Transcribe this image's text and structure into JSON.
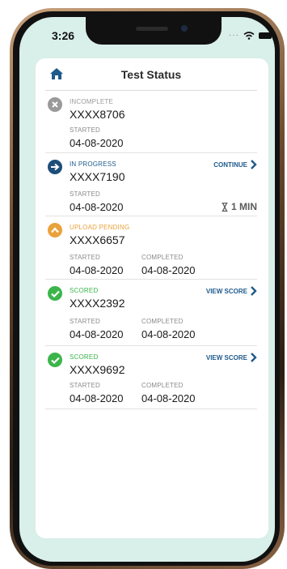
{
  "status_bar": {
    "time": "3:26"
  },
  "header": {
    "title": "Test Status"
  },
  "colors": {
    "complete_green": "#3bb54a",
    "blue": "#1e5a8c",
    "orange": "#e9a23b",
    "grey": "#9a9a9a"
  },
  "tests": [
    {
      "status": "INCOMPLETE",
      "status_color": "#9a9a9a",
      "icon": "x-icon",
      "id": "XXXX8706",
      "started_label": "STARTED",
      "started": "04-08-2020"
    },
    {
      "status": "IN PROGRESS",
      "status_color": "#1e5a8c",
      "icon": "arrow-right-icon",
      "id": "XXXX7190",
      "started_label": "STARTED",
      "started": "04-08-2020",
      "action": "CONTINUE",
      "timer": "1 MIN"
    },
    {
      "status": "UPLOAD PENDING",
      "status_color": "#e9a23b",
      "icon": "chevron-up-icon",
      "id": "XXXX6657",
      "started_label": "STARTED",
      "started": "04-08-2020",
      "completed_label": "COMPLETED",
      "completed": "04-08-2020"
    },
    {
      "status": "SCORED",
      "status_color": "#3bb54a",
      "icon": "check-icon",
      "id": "XXXX2392",
      "started_label": "STARTED",
      "started": "04-08-2020",
      "completed_label": "COMPLETED",
      "completed": "04-08-2020",
      "action": "VIEW SCORE"
    },
    {
      "status": "SCORED",
      "status_color": "#3bb54a",
      "icon": "check-icon",
      "id": "XXXX9692",
      "started_label": "STARTED",
      "started": "04-08-2020",
      "completed_label": "COMPLETED",
      "completed": "04-08-2020",
      "action": "VIEW SCORE"
    }
  ]
}
